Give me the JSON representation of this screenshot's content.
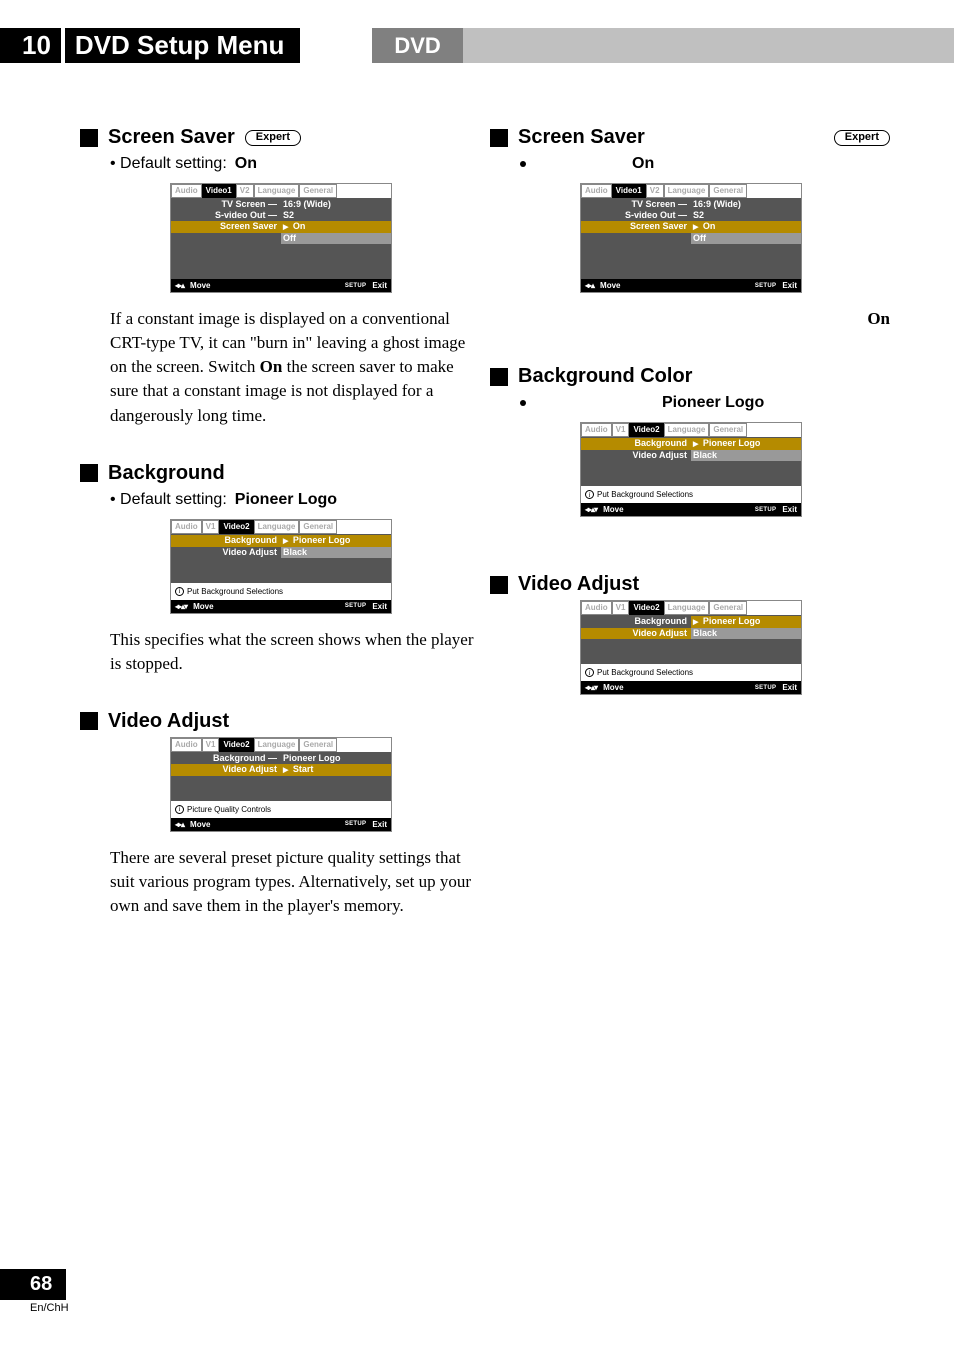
{
  "header": {
    "chapter_num": "10",
    "chapter_title": "DVD Setup Menu",
    "dvd_label": "DVD"
  },
  "left": {
    "screen_saver": {
      "title": "Screen Saver",
      "badge": "Expert",
      "default_label": "Default setting:",
      "default_value": "On",
      "body": "If a constant image is displayed on a conventional CRT-type TV, it can “burn in” leaving a ghost image on the screen. Switch On the screen saver to make sure that a constant image is not displayed for a dangerously long time.",
      "body_bold": "On",
      "osd": {
        "tabs": [
          "Audio",
          "Video1",
          "V2",
          "Language",
          "General"
        ],
        "active_tab": 1,
        "rows": [
          {
            "lbl": "TV Screen",
            "sep": "—",
            "val": "16:9 (Wide)"
          },
          {
            "lbl": "S-video Out",
            "sep": "—",
            "val": "S2"
          },
          {
            "lbl": "Screen Saver",
            "sep": "",
            "val": "On",
            "hl_lbl": true,
            "sel_val": true
          },
          {
            "lbl": "",
            "sep": "",
            "val": "Off",
            "list": true
          }
        ],
        "foot_move": "Move",
        "foot_setup": "SETUP",
        "foot_exit": "Exit",
        "arrows": "◂▸▴"
      }
    },
    "background": {
      "title": "Background",
      "default_label": "Default setting:",
      "default_value": "Pioneer Logo",
      "body": "This specifies what the screen shows when the player is stopped.",
      "osd": {
        "tabs": [
          "Audio",
          "V1",
          "Video2",
          "Language",
          "General"
        ],
        "active_tab": 2,
        "rows": [
          {
            "lbl": "Background",
            "sep": "",
            "val": "Pioneer Logo",
            "hl_lbl": true,
            "sel_val": true
          },
          {
            "lbl": "Video Adjust",
            "sep": "",
            "val": "Black",
            "list": true
          }
        ],
        "note": "Put Background Selections",
        "foot_move": "Move",
        "foot_setup": "SETUP",
        "foot_exit": "Exit",
        "arrows": "◂▸▴▾"
      }
    },
    "video_adjust": {
      "title": "Video Adjust",
      "body": "There are several preset picture quality settings that suit various program types. Alternatively, set up your own and save them in the player's memory.",
      "osd": {
        "tabs": [
          "Audio",
          "V1",
          "Video2",
          "Language",
          "General"
        ],
        "active_tab": 2,
        "rows": [
          {
            "lbl": "Background",
            "sep": "—",
            "val": "Pioneer Logo"
          },
          {
            "lbl": "Video Adjust",
            "sep": "",
            "val": "Start",
            "hl_lbl": true,
            "sel_val": true
          }
        ],
        "note": "Picture Quality Controls",
        "foot_move": "Move",
        "foot_setup": "SETUP",
        "foot_exit": "Exit",
        "arrows": "◂▸▴"
      }
    }
  },
  "right": {
    "screen_saver": {
      "title": "Screen Saver",
      "badge": "Expert",
      "default_value": "On",
      "body_bold": "On",
      "osd": {
        "tabs": [
          "Audio",
          "Video1",
          "V2",
          "Language",
          "General"
        ],
        "active_tab": 1,
        "rows": [
          {
            "lbl": "TV Screen",
            "sep": "—",
            "val": "16:9 (Wide)"
          },
          {
            "lbl": "S-video Out",
            "sep": "—",
            "val": "S2"
          },
          {
            "lbl": "Screen Saver",
            "sep": "",
            "val": "On",
            "hl_lbl": true,
            "sel_val": true
          },
          {
            "lbl": "",
            "sep": "",
            "val": "Off",
            "list": true
          }
        ],
        "foot_move": "Move",
        "foot_setup": "SETUP",
        "foot_exit": "Exit",
        "arrows": "◂▸▴"
      }
    },
    "background": {
      "title": "Background Color",
      "default_value": "Pioneer Logo",
      "osd": {
        "tabs": [
          "Audio",
          "V1",
          "Video2",
          "Language",
          "General"
        ],
        "active_tab": 2,
        "rows": [
          {
            "lbl": "Background",
            "sep": "",
            "val": "Pioneer Logo",
            "hl_lbl": true,
            "sel_val": true
          },
          {
            "lbl": "Video Adjust",
            "sep": "",
            "val": "Black",
            "list": true
          }
        ],
        "note": "Put Background Selections",
        "foot_move": "Move",
        "foot_setup": "SETUP",
        "foot_exit": "Exit",
        "arrows": "◂▸▴▾"
      }
    },
    "video_adjust": {
      "title": "Video Adjust",
      "osd": {
        "tabs": [
          "Audio",
          "V1",
          "Video2",
          "Language",
          "General"
        ],
        "active_tab": 2,
        "rows": [
          {
            "lbl": "Background",
            "sep": "",
            "val": "Pioneer Logo",
            "sel_val": true
          },
          {
            "lbl": "Video Adjust",
            "sep": "",
            "val": "Black",
            "hl_lbl": true,
            "list": true
          }
        ],
        "note": "Put Background Selections",
        "foot_move": "Move",
        "foot_setup": "SETUP",
        "foot_exit": "Exit",
        "arrows": "◂▸▴▾"
      }
    }
  },
  "footer": {
    "page": "68",
    "lang": "En/ChH"
  }
}
